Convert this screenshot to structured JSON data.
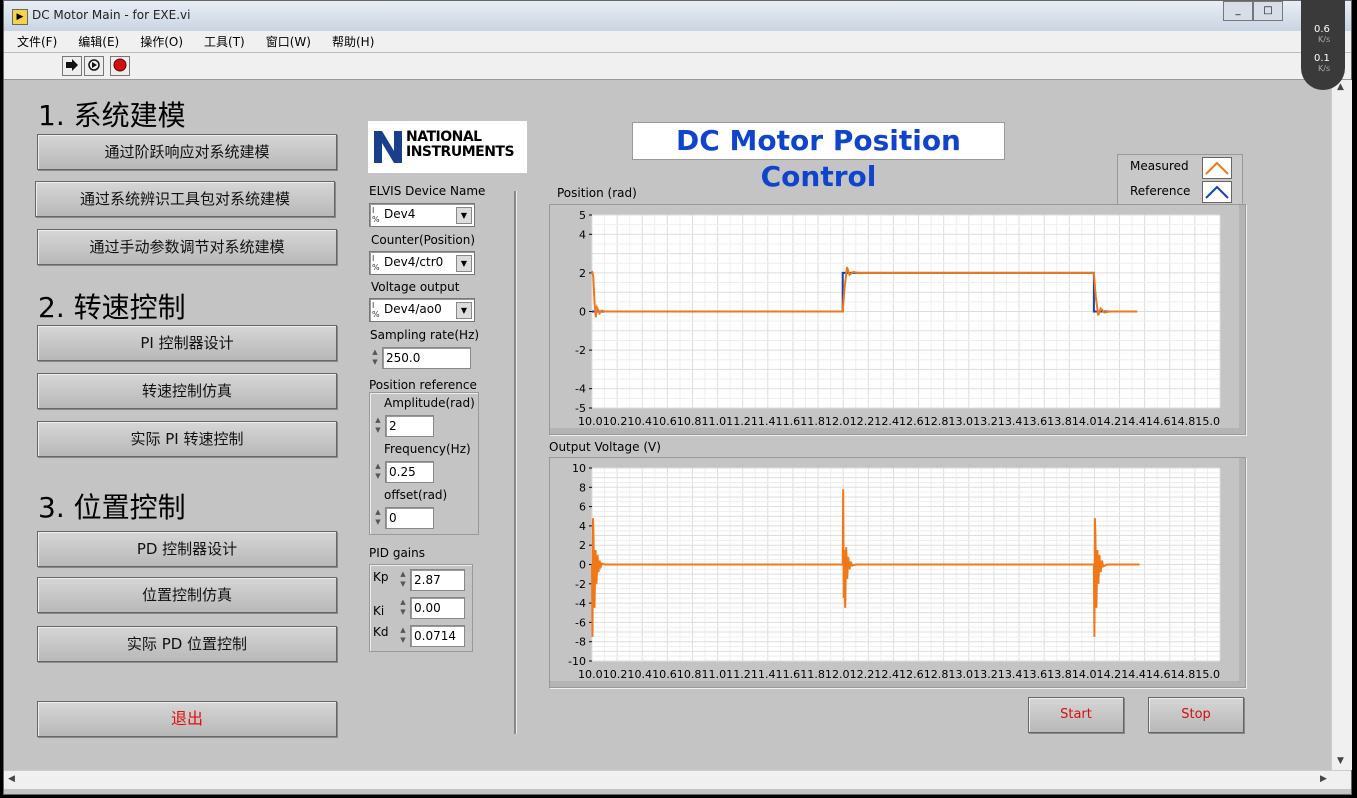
{
  "window": {
    "title": "DC Motor Main - for EXE.vi",
    "buttons": [
      "_",
      "□"
    ]
  },
  "menu": [
    "文件(F)",
    "编辑(E)",
    "操作(O)",
    "工具(T)",
    "窗口(W)",
    "帮助(H)"
  ],
  "toolbar": {
    "run_icon": "run-arrow-icon",
    "continuous_icon": "continuous-run-icon",
    "abort_icon": "abort-stop-icon"
  },
  "net_widget": {
    "up": "0.6",
    "up_unit": "K/s",
    "down": "0.1",
    "down_unit": "K/s"
  },
  "sections": [
    {
      "title": "1. 系统建模",
      "buttons": [
        "通过阶跃响应对系统建模",
        "通过系统辨识工具包对系统建模",
        "通过手动参数调节对系统建模"
      ]
    },
    {
      "title": "2. 转速控制",
      "buttons": [
        "PI 控制器设计",
        "转速控制仿真",
        "实际 PI 转速控制"
      ]
    },
    {
      "title": "3. 位置控制",
      "buttons": [
        "PD 控制器设计",
        "位置控制仿真",
        "实际 PD 位置控制"
      ]
    }
  ],
  "exit_label": "退出",
  "logo": {
    "line1": "NATIONAL",
    "line2": "INSTRUMENTS",
    "icon": "ni-eagle-logo"
  },
  "config": {
    "device_label": "ELVIS Device Name",
    "device_value": "Dev4",
    "counter_label": "Counter(Position)",
    "counter_value": "Dev4/ctr0",
    "voltage_label": "Voltage output",
    "voltage_value": "Dev4/ao0",
    "rate_label": "Sampling rate(Hz)",
    "rate_value": "250.0",
    "posref_label": "Position reference",
    "amp_label": "Amplitude(rad)",
    "amp_value": "2",
    "freq_label": "Frequency(Hz)",
    "freq_value": "0.25",
    "offset_label": "offset(rad)",
    "offset_value": "0",
    "pid_label": "PID gains",
    "kp_label": "Kp",
    "kp_value": "2.87",
    "ki_label": "Ki",
    "ki_value": "0.00",
    "kd_label": "Kd",
    "kd_value": "0.0714"
  },
  "main_title": "DC Motor Position Control",
  "legend": [
    {
      "name": "Measured",
      "color": "#f07818"
    },
    {
      "name": "Reference",
      "color": "#1040c0"
    }
  ],
  "buttons": {
    "start": "Start",
    "stop": "Stop"
  },
  "chart_data": [
    {
      "type": "line",
      "title": "Position (rad)",
      "ylim": [
        -5,
        5
      ],
      "yticks": [
        "5",
        "4",
        "2",
        "0",
        "-2",
        "-4",
        "-5"
      ],
      "xlim": [
        10.0,
        15.0
      ],
      "xtick_text": "10.010.210.410.610.811.011.211.411.611.812.012.212.412.612.813.013.213.413.613.814.014.214.414.614.815.0",
      "series": [
        {
          "name": "Reference",
          "color": "#1040c0",
          "x": [
            10.0,
            10.02,
            10.02,
            11.996,
            11.996,
            13.996,
            13.996,
            14.34
          ],
          "y": [
            0,
            0,
            0,
            0,
            2,
            2,
            0,
            0
          ]
        },
        {
          "name": "Measured",
          "color": "#f07818",
          "x": [
            10.0,
            10.01,
            10.02,
            10.03,
            10.04,
            10.06,
            10.08,
            10.1,
            11.996,
            12.01,
            12.03,
            12.05,
            12.08,
            12.12,
            13.996,
            14.01,
            14.03,
            14.05,
            14.08,
            14.12,
            14.34
          ],
          "y": [
            2.1,
            1.8,
            0.5,
            -0.3,
            0.2,
            -0.1,
            0.05,
            0,
            0,
            1.2,
            2.3,
            1.9,
            2.05,
            2.0,
            2.0,
            0.8,
            -0.2,
            0.15,
            -0.05,
            0,
            0
          ]
        }
      ]
    },
    {
      "type": "line",
      "title": "Output Voltage (V)",
      "ylim": [
        -10,
        10
      ],
      "yticks": [
        "10",
        "8",
        "6",
        "4",
        "2",
        "0",
        "-2",
        "-4",
        "-6",
        "-8",
        "-10"
      ],
      "xlim": [
        10.0,
        15.0
      ],
      "xtick_text": "10.010.210.410.610.811.011.211.411.611.812.012.212.412.612.813.013.213.413.613.814.014.214.414.614.815.0",
      "series": [
        {
          "name": "Measured",
          "color": "#f07818",
          "x": [
            10.0,
            10.004,
            10.008,
            10.012,
            10.02,
            10.028,
            10.036,
            10.044,
            10.052,
            10.06,
            10.07,
            10.08,
            10.1,
            11.996,
            12.0,
            12.004,
            12.008,
            12.016,
            12.024,
            12.032,
            12.04,
            12.05,
            12.06,
            12.07,
            12.1,
            13.996,
            14.0,
            14.004,
            14.008,
            14.016,
            14.024,
            14.032,
            14.04,
            14.05,
            14.06,
            14.07,
            14.1,
            14.36
          ],
          "y": [
            0,
            -7.5,
            4.8,
            3.0,
            -4.5,
            1.5,
            -2.0,
            1.0,
            -0.8,
            0.4,
            -0.2,
            0.1,
            0,
            0,
            7.8,
            -3.5,
            1.5,
            -4.5,
            1.8,
            -1.5,
            0.8,
            -0.5,
            0.3,
            -0.1,
            0,
            0,
            -7.5,
            4.8,
            3.0,
            -4.5,
            1.5,
            -2.0,
            1.0,
            -0.8,
            0.4,
            -0.2,
            0,
            0
          ]
        }
      ]
    }
  ]
}
